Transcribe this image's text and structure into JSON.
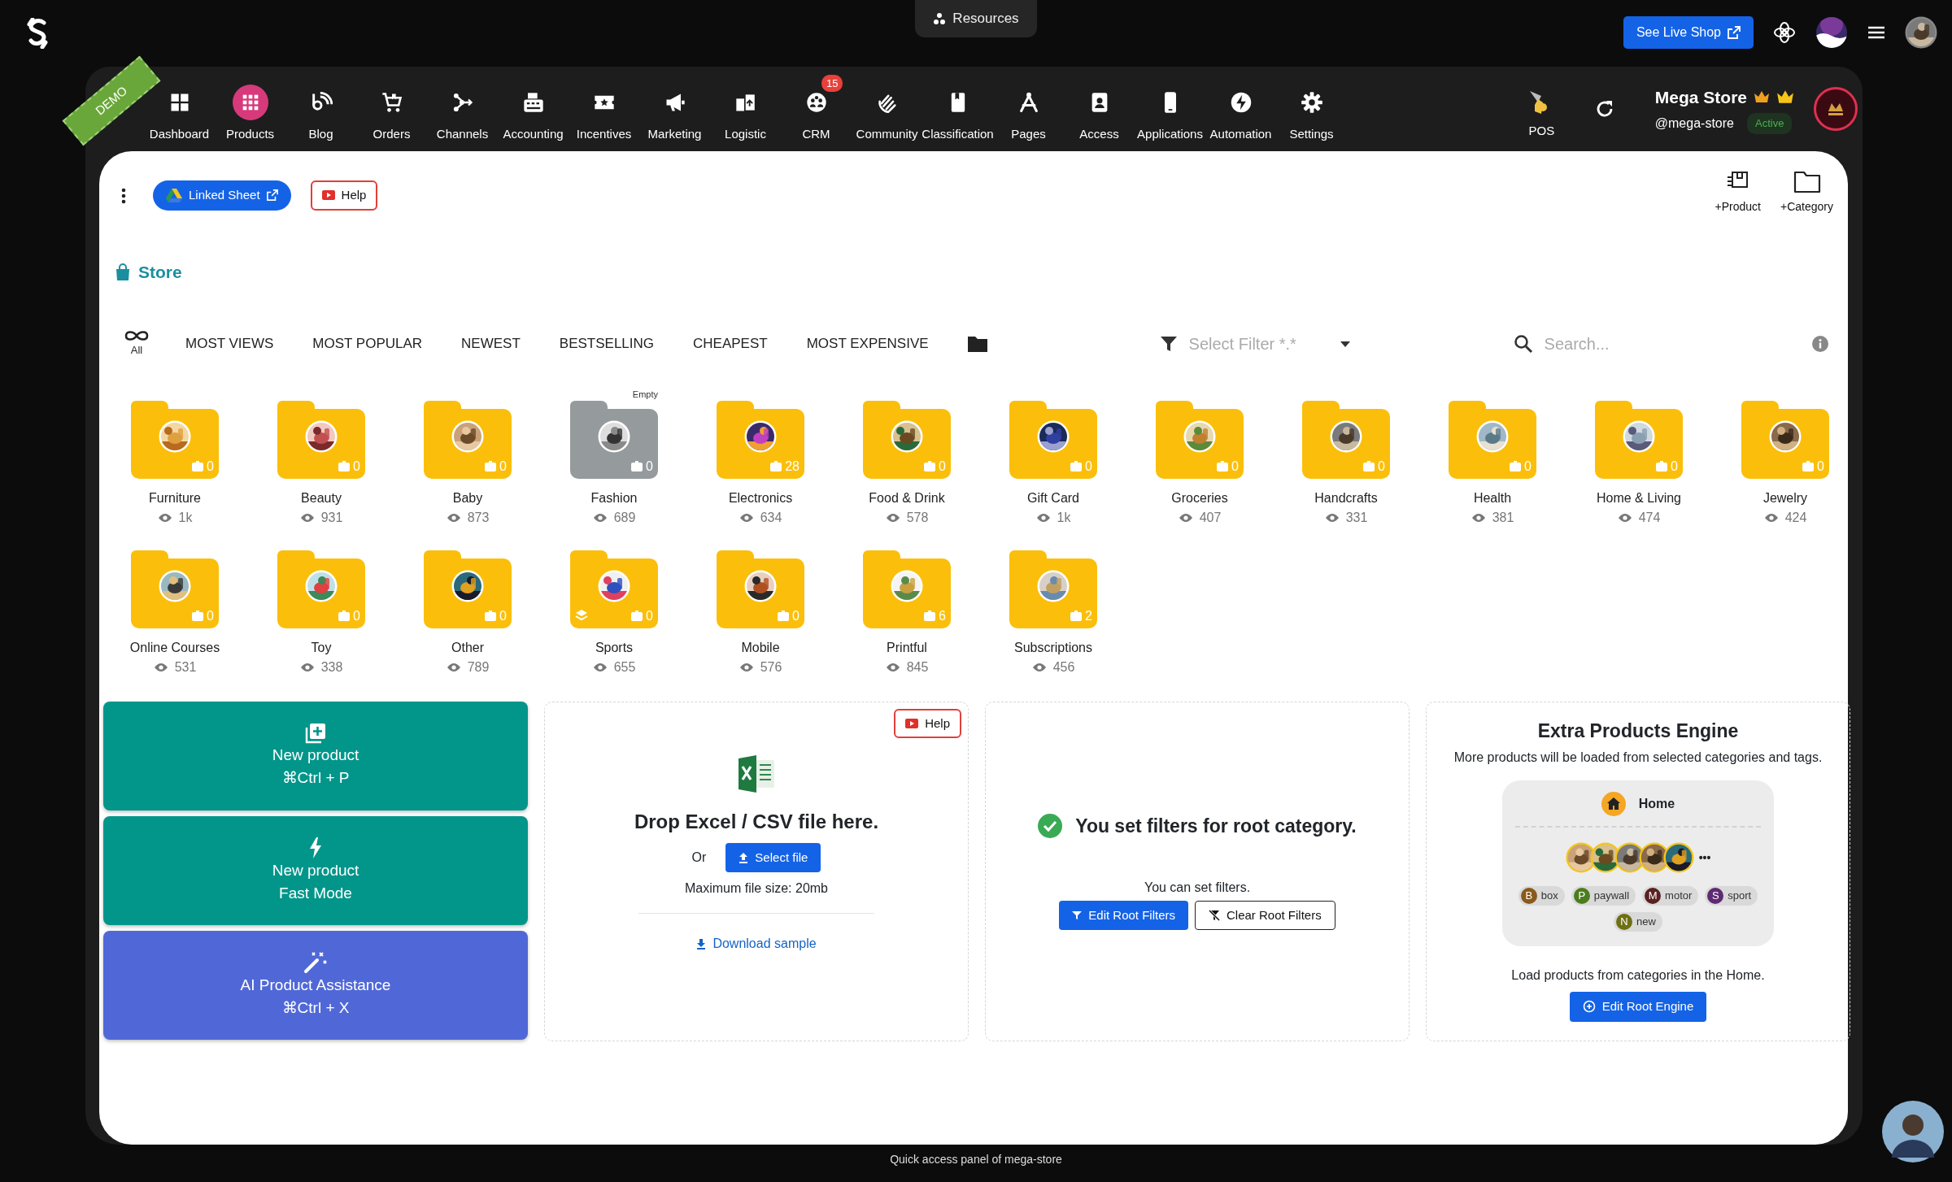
{
  "top_bar": {
    "resources_button": "Resources",
    "live_shop_button": "See Live Shop"
  },
  "nav": {
    "demo_ribbon": "DEMO",
    "items": [
      {
        "label": "Dashboard",
        "selected": false
      },
      {
        "label": "Products",
        "selected": true
      },
      {
        "label": "Blog",
        "selected": false
      },
      {
        "label": "Orders",
        "selected": false
      },
      {
        "label": "Channels",
        "selected": false
      },
      {
        "label": "Accounting",
        "selected": false
      },
      {
        "label": "Incentives",
        "selected": false
      },
      {
        "label": "Marketing",
        "selected": false
      },
      {
        "label": "Logistic",
        "selected": false
      },
      {
        "label": "CRM",
        "selected": false,
        "badge": "15"
      },
      {
        "label": "Community",
        "selected": false
      },
      {
        "label": "Classification",
        "selected": false
      },
      {
        "label": "Pages",
        "selected": false
      },
      {
        "label": "Access",
        "selected": false
      },
      {
        "label": "Applications",
        "selected": false
      },
      {
        "label": "Automation",
        "selected": false
      },
      {
        "label": "Settings",
        "selected": false
      }
    ],
    "pos": "POS",
    "store": {
      "name": "Mega Store",
      "handle": "@mega-store",
      "status": "Active"
    }
  },
  "toolbar": {
    "linked_sheet": "Linked Sheet",
    "help": "Help",
    "actions": [
      "+Product",
      "+Category"
    ]
  },
  "breadcrumb": "Store",
  "sort_tabs": {
    "all": "All",
    "items": [
      "MOST VIEWS",
      "MOST POPULAR",
      "NEWEST",
      "BESTSELLING",
      "CHEAPEST",
      "MOST EXPENSIVE"
    ]
  },
  "filter": {
    "placeholder": "Select Filter *.*"
  },
  "search": {
    "placeholder": "Search..."
  },
  "categories": [
    {
      "name": "Furniture",
      "views": "1k",
      "count": "0",
      "empty": false,
      "layered": false
    },
    {
      "name": "Beauty",
      "views": "931",
      "count": "0",
      "empty": false,
      "layered": false
    },
    {
      "name": "Baby",
      "views": "873",
      "count": "0",
      "empty": false,
      "layered": false
    },
    {
      "name": "Fashion",
      "views": "689",
      "count": "0",
      "empty": true,
      "empty_label": "Empty",
      "layered": false
    },
    {
      "name": "Electronics",
      "views": "634",
      "count": "28",
      "empty": false,
      "layered": false
    },
    {
      "name": "Food & Drink",
      "views": "578",
      "count": "0",
      "empty": false,
      "layered": false
    },
    {
      "name": "Gift Card",
      "views": "1k",
      "count": "0",
      "empty": false,
      "layered": false
    },
    {
      "name": "Groceries",
      "views": "407",
      "count": "0",
      "empty": false,
      "layered": false
    },
    {
      "name": "Handcrafts",
      "views": "331",
      "count": "0",
      "empty": false,
      "layered": false
    },
    {
      "name": "Health",
      "views": "381",
      "count": "0",
      "empty": false,
      "layered": false
    },
    {
      "name": "Home & Living",
      "views": "474",
      "count": "0",
      "empty": false,
      "layered": false
    },
    {
      "name": "Jewelry",
      "views": "424",
      "count": "0",
      "empty": false,
      "layered": false
    },
    {
      "name": "Online Courses",
      "views": "531",
      "count": "0",
      "empty": false,
      "layered": false
    },
    {
      "name": "Toy",
      "views": "338",
      "count": "0",
      "empty": false,
      "layered": false
    },
    {
      "name": "Other",
      "views": "789",
      "count": "0",
      "empty": false,
      "layered": false
    },
    {
      "name": "Sports",
      "views": "655",
      "count": "0",
      "empty": false,
      "layered": true
    },
    {
      "name": "Mobile",
      "views": "576",
      "count": "0",
      "empty": false,
      "layered": false
    },
    {
      "name": "Printful",
      "views": "845",
      "count": "6",
      "empty": false,
      "layered": false
    },
    {
      "name": "Subscriptions",
      "views": "456",
      "count": "2",
      "empty": false,
      "layered": false
    }
  ],
  "quick_actions": [
    {
      "kind": "create",
      "title": "New product",
      "subtitle": "⌘Ctrl + P"
    },
    {
      "kind": "fast",
      "title": "New product",
      "subtitle": "Fast Mode"
    },
    {
      "kind": "ai",
      "title": "AI Product Assistance",
      "subtitle": "⌘Ctrl + X"
    }
  ],
  "import": {
    "help": "Help",
    "title": "Drop Excel / CSV file here.",
    "or": "Or",
    "select_button": "Select file",
    "max_size": "Maximum file size: 20mb",
    "download_link": "Download sample"
  },
  "root_filters": {
    "title": "You set filters for root category.",
    "hint": "You can set filters.",
    "edit_button": "Edit Root Filters",
    "clear_button": "Clear Root Filters"
  },
  "engine": {
    "title": "Extra Products Engine",
    "subtitle": "More products will be loaded from selected categories and tags.",
    "category": "Home",
    "more": "•••",
    "tags": [
      {
        "letter": "B",
        "label": "box",
        "color": "#8a5a1c"
      },
      {
        "letter": "P",
        "label": "paywall",
        "color": "#4b7d1e"
      },
      {
        "letter": "M",
        "label": "motor",
        "color": "#5a2222"
      },
      {
        "letter": "S",
        "label": "sport",
        "color": "#5e2a72"
      },
      {
        "letter": "N",
        "label": "new",
        "color": "#6f6f14"
      }
    ],
    "note": "Load products from categories in the Home.",
    "button": "Edit Root Engine"
  },
  "footer": "Quick access panel of mega-store"
}
